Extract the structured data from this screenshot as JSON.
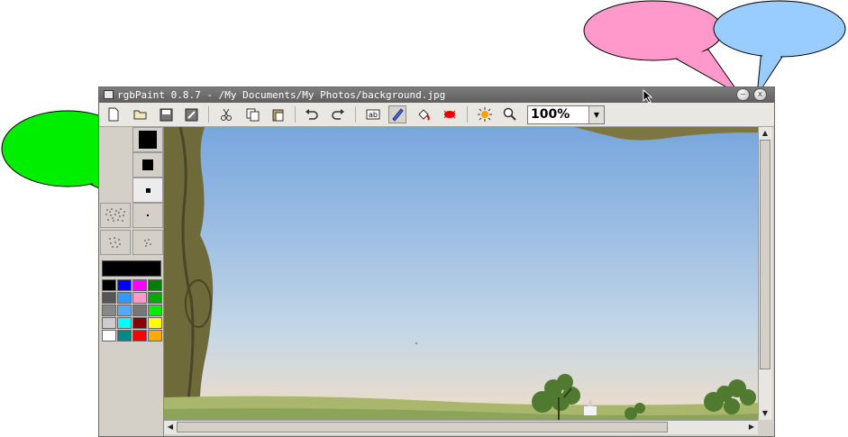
{
  "window": {
    "title": "rgbPaint 0.8.7 - /My Documents/My Photos/background.jpg",
    "minimize_label": "—",
    "close_label": "x"
  },
  "toolbar": {
    "buttons": [
      {
        "name": "new-file",
        "icon": "new-document-icon"
      },
      {
        "name": "open-file",
        "icon": "folder-open-icon"
      },
      {
        "name": "save-file",
        "icon": "floppy-disk-icon"
      },
      {
        "name": "save-as",
        "icon": "save-as-icon"
      },
      {
        "name": "cut",
        "icon": "scissors-icon"
      },
      {
        "name": "copy",
        "icon": "copy-icon"
      },
      {
        "name": "paste",
        "icon": "clipboard-icon"
      },
      {
        "name": "undo",
        "icon": "undo-icon"
      },
      {
        "name": "redo",
        "icon": "redo-icon"
      },
      {
        "name": "text-tool",
        "icon": "text-tool-icon"
      },
      {
        "name": "pencil-tool",
        "icon": "pencil-icon"
      },
      {
        "name": "fill-tool",
        "icon": "paint-bucket-icon"
      },
      {
        "name": "spray-tool",
        "icon": "spray-icon"
      },
      {
        "name": "brightness",
        "icon": "sun-icon"
      },
      {
        "name": "zoom-tool",
        "icon": "magnifier-icon"
      }
    ],
    "active_tool": "pencil-tool",
    "zoom_value": "100%"
  },
  "palette": {
    "foreground": "#000000",
    "colors": [
      [
        "#000000",
        "#0000ff",
        "#ff00ff",
        "#007f00"
      ],
      [
        "#555555",
        "#3399ff",
        "#ff99cc",
        "#00aa00"
      ],
      [
        "#888888",
        "#55aaff",
        "#777777",
        "#00ee00"
      ],
      [
        "#cccccc",
        "#00ffff",
        "#880000",
        "#ffff00"
      ],
      [
        "#ffffff",
        "#008888",
        "#ff0000",
        "#ffaa00"
      ]
    ]
  },
  "annotations": {
    "green_balloon": "#00ee00",
    "pink_balloon": "#ff99cc",
    "blue_balloon": "#99ccff"
  }
}
